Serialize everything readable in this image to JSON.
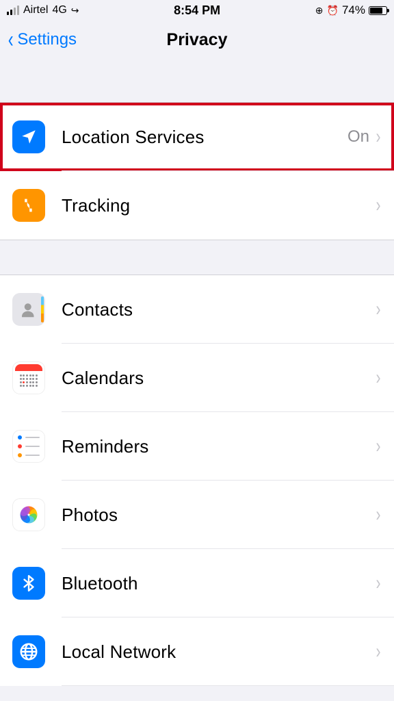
{
  "status": {
    "carrier": "Airtel",
    "network": "4G",
    "time": "8:54 PM",
    "battery_pct": "74%"
  },
  "nav": {
    "back_label": "Settings",
    "title": "Privacy"
  },
  "section1": [
    {
      "label": "Location Services",
      "value": "On",
      "highlight": true
    },
    {
      "label": "Tracking",
      "value": ""
    }
  ],
  "section2": [
    {
      "label": "Contacts"
    },
    {
      "label": "Calendars"
    },
    {
      "label": "Reminders"
    },
    {
      "label": "Photos"
    },
    {
      "label": "Bluetooth"
    },
    {
      "label": "Local Network"
    }
  ]
}
